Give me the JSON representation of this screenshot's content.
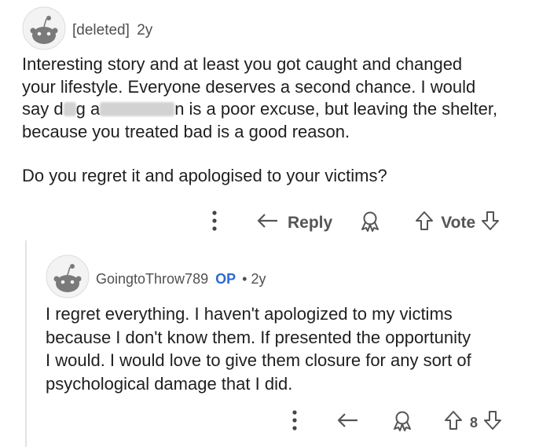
{
  "comment": {
    "username": "[deleted]",
    "age": "2y",
    "lines": [
      "Interesting story and at least you got caught and changed",
      "your lifestyle. Everyone deserves a second chance. I would",
      "because you treated bad is a good reason."
    ],
    "line3_parts": [
      "say d",
      "g a",
      "n is a poor excuse, but leaving the shelter,"
    ],
    "question": "Do you regret it and apologised to your victims?",
    "reply_label": "Reply",
    "vote_label": "Vote"
  },
  "reply": {
    "username": "GoingtoThrow789",
    "op_badge": "OP",
    "separator": "•",
    "age": "2y",
    "lines": [
      "I regret everything. I haven't apologized to my victims",
      "because I don't know them. If presented the opportunity",
      "I would. I would love to give them closure for any sort of",
      "psychological damage that I did."
    ],
    "vote_count": "8"
  },
  "icons": [
    "more-icon",
    "reply-arrow-icon",
    "award-icon",
    "upvote-icon",
    "downvote-icon",
    "snoo-avatar-icon"
  ],
  "colors": {
    "op": "#2e6bd0",
    "text": "#1f1f1f",
    "meta": "#505050"
  }
}
